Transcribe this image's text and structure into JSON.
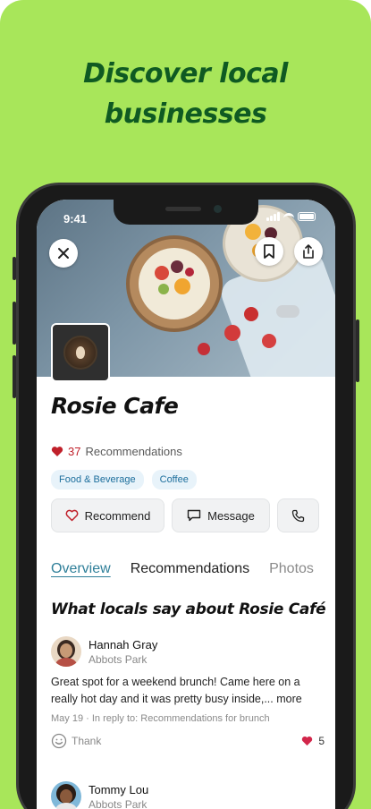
{
  "headline": {
    "line1": "Discover local",
    "line2": "businesses"
  },
  "status_bar": {
    "time": "9:41"
  },
  "business": {
    "name": "Rosie Cafe",
    "recommendations_count": "37",
    "recommendations_label": "Recommendations",
    "tags": [
      "Food & Beverage",
      "Coffee"
    ]
  },
  "actions": {
    "recommend": "Recommend",
    "message": "Message"
  },
  "tabs": [
    "Overview",
    "Recommendations",
    "Photos"
  ],
  "section_title": "What locals say about Rosie Café",
  "reviews": [
    {
      "name": "Hannah Gray",
      "location": "Abbots Park",
      "text": "Great spot for a weekend brunch! Came here on a really hot day and it was pretty busy inside,... more",
      "meta": "May 19 · In reply to: Recommendations for brunch",
      "thank_label": "Thank",
      "likes": "5"
    },
    {
      "name": "Tommy Lou",
      "location": "Abbots Park"
    }
  ],
  "colors": {
    "background": "#a8e65a",
    "headline": "#0f5a22",
    "accent_tab": "#2f7f99",
    "heart": "#c0202a",
    "tag_bg": "#e8f3fa",
    "tag_text": "#1c6e9c"
  },
  "icons": [
    "close-icon",
    "bookmark-icon",
    "share-icon",
    "heart-icon",
    "message-icon",
    "phone-icon",
    "smile-icon"
  ]
}
